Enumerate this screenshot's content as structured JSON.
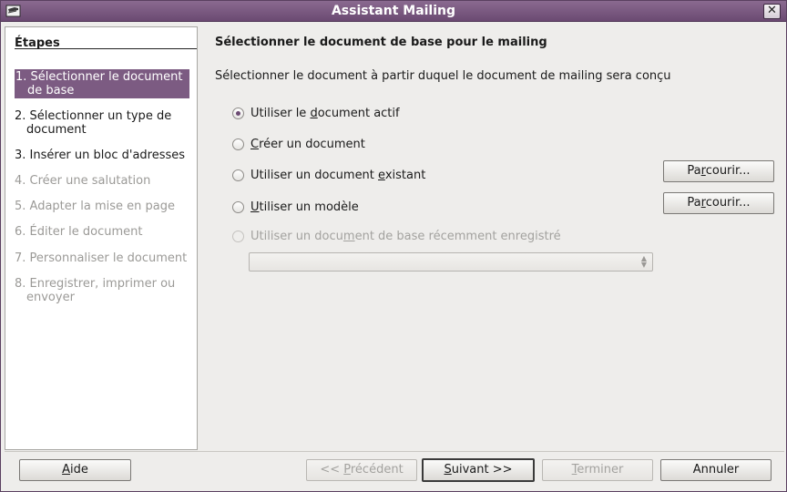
{
  "window": {
    "title": "Assistant Mailing",
    "close_symbol": "✕"
  },
  "steps": {
    "title": "Étapes",
    "items": [
      {
        "label_lines": [
          "1. Sélectionner le document",
          "de base"
        ],
        "state": "active"
      },
      {
        "label_lines": [
          "2. Sélectionner un type de",
          "document"
        ],
        "state": "enabled"
      },
      {
        "label_lines": [
          "3. Insérer un bloc d'adresses"
        ],
        "state": "enabled"
      },
      {
        "label_lines": [
          "4. Créer une salutation"
        ],
        "state": "disabled"
      },
      {
        "label_lines": [
          "5. Adapter la mise en page"
        ],
        "state": "disabled"
      },
      {
        "label_lines": [
          "6. Éditer le document"
        ],
        "state": "disabled"
      },
      {
        "label_lines": [
          "7. Personnaliser le document"
        ],
        "state": "disabled"
      },
      {
        "label_lines": [
          "8. Enregistrer, imprimer ou",
          "envoyer"
        ],
        "state": "disabled"
      }
    ]
  },
  "main": {
    "title": "Sélectionner le document de base pour le mailing",
    "description": "Sélectionner le document à partir duquel le document de mailing sera conçu",
    "options": {
      "active_doc": {
        "pre": "Utiliser le ",
        "key": "d",
        "post": "ocument actif",
        "checked": true,
        "disabled": false
      },
      "new_doc": {
        "pre": "",
        "key": "C",
        "post": "réer un document",
        "checked": false,
        "disabled": false
      },
      "existing_doc": {
        "pre": "Utiliser un document ",
        "key": "e",
        "post": "xistant",
        "checked": false,
        "disabled": false
      },
      "template": {
        "pre": "",
        "key": "U",
        "post": "tiliser un modèle",
        "checked": false,
        "disabled": false
      },
      "recent_doc": {
        "pre": "Utiliser un docu",
        "key": "m",
        "post": "ent de base récemment enregistré",
        "checked": false,
        "disabled": true
      }
    },
    "browse_existing": {
      "pre": "Pa",
      "key": "r",
      "post": "courir..."
    },
    "browse_template": {
      "pre": "Pa",
      "key": "r",
      "post": "courir..."
    },
    "recent_combo_value": ""
  },
  "footer": {
    "help": {
      "pre": "",
      "key": "A",
      "post": "ide"
    },
    "previous": {
      "pre": "<< ",
      "key": "P",
      "post": "récédent"
    },
    "next": {
      "pre": "",
      "key": "S",
      "post": "uivant >>"
    },
    "finish": {
      "pre": "",
      "key": "T",
      "post": "erminer"
    },
    "cancel": {
      "pre": "Annuler",
      "key": "",
      "post": ""
    }
  },
  "colors": {
    "titlebar": "#6b4a72",
    "active_step_bg": "#7c5b82",
    "radio_dot": "#6b4a72"
  }
}
